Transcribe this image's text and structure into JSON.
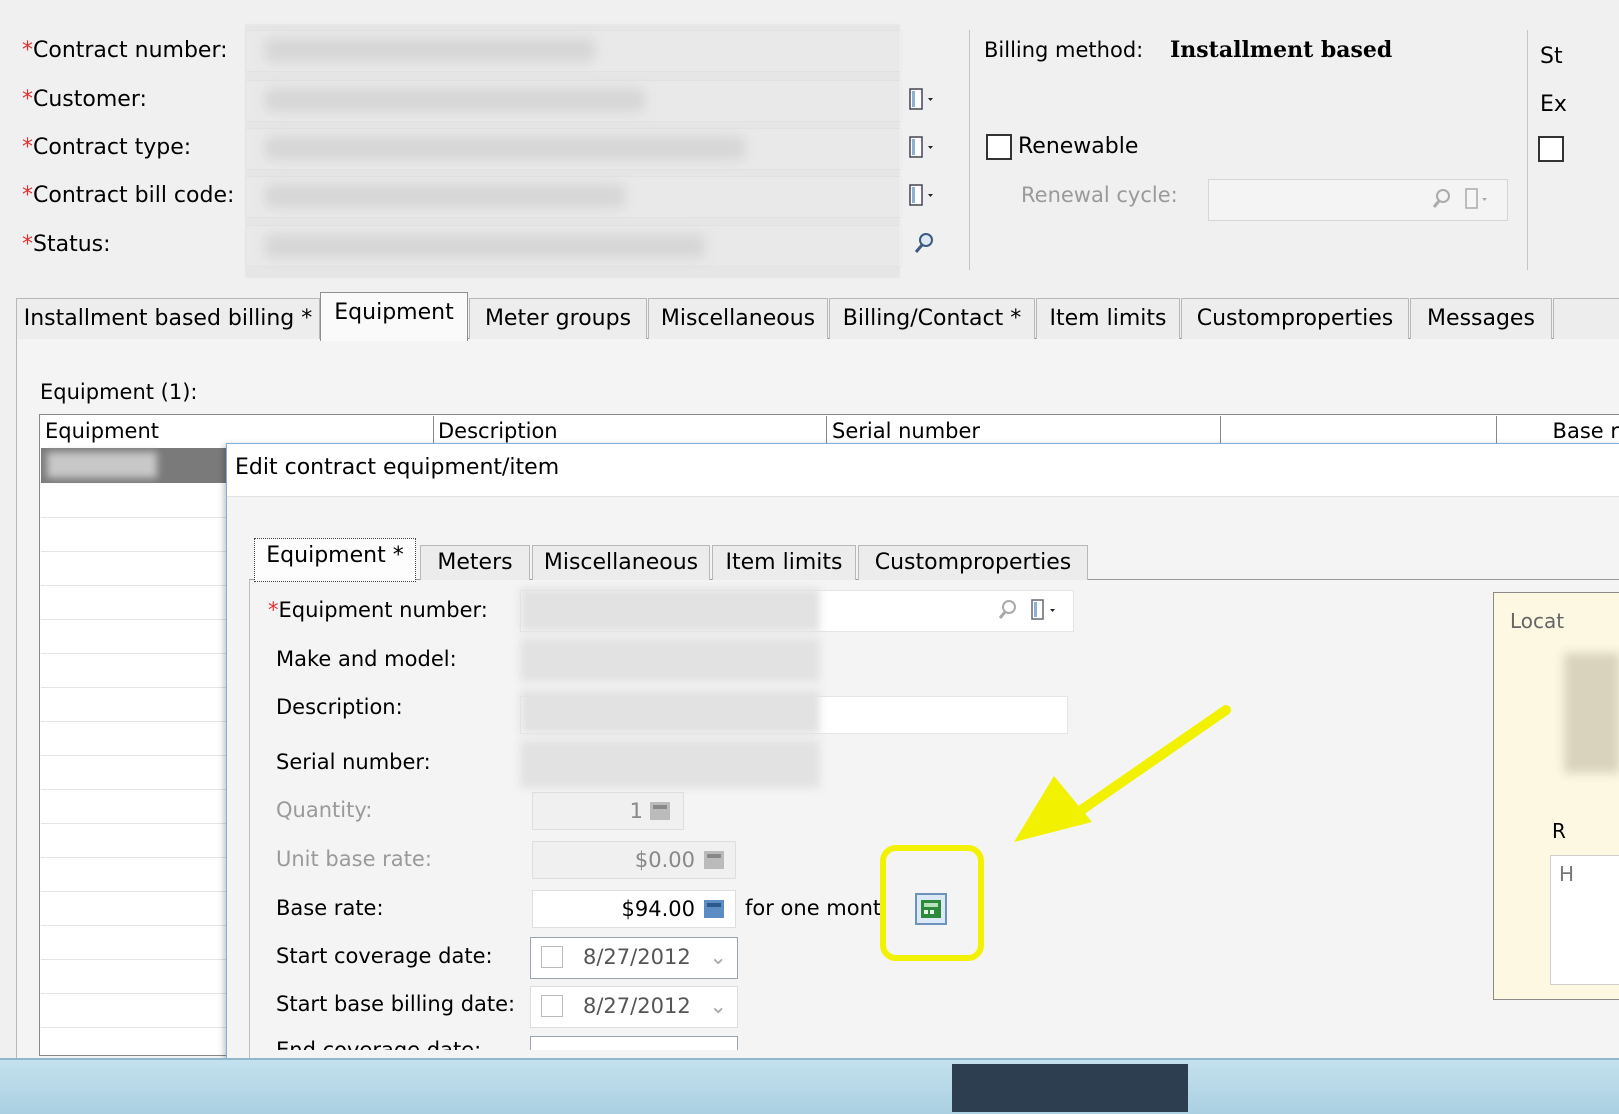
{
  "header": {
    "fields": [
      {
        "label": "Contract number:",
        "required": true
      },
      {
        "label": "Customer:",
        "required": true
      },
      {
        "label": "Contract type:",
        "required": true
      },
      {
        "label": "Contract bill code:",
        "required": true
      },
      {
        "label": "Status:",
        "required": true
      }
    ],
    "billing_method_label": "Billing method:",
    "billing_method_value": "Installment based",
    "renewable_label": "Renewable",
    "renewal_cycle_label": "Renewal cycle:",
    "right_partial_1": "St",
    "right_partial_2": "Ex"
  },
  "tabs": [
    {
      "label": "Installment based billing *",
      "active": false
    },
    {
      "label": "Equipment",
      "active": true
    },
    {
      "label": "Meter groups",
      "active": false
    },
    {
      "label": "Miscellaneous",
      "active": false
    },
    {
      "label": "Billing/Contact *",
      "active": false
    },
    {
      "label": "Item limits",
      "active": false
    },
    {
      "label": "Customproperties",
      "active": false
    },
    {
      "label": "Messages",
      "active": false
    }
  ],
  "equipment_section": {
    "title": "Equipment (1):",
    "columns": [
      "Equipment",
      "Description",
      "Serial number",
      "",
      "Base r"
    ]
  },
  "dialog": {
    "title": "Edit contract equipment/item",
    "tabs": [
      {
        "label": "Equipment *",
        "active": true
      },
      {
        "label": "Meters",
        "active": false
      },
      {
        "label": "Miscellaneous",
        "active": false
      },
      {
        "label": "Item limits",
        "active": false
      },
      {
        "label": "Customproperties",
        "active": false
      }
    ],
    "fields": {
      "equipment_number_label": "Equipment number:",
      "make_model_label": "Make and model:",
      "description_label": "Description:",
      "serial_label": "Serial number:",
      "quantity_label": "Quantity:",
      "quantity_value": "1",
      "unit_base_rate_label": "Unit base rate:",
      "unit_base_rate_value": "$0.00",
      "base_rate_label": "Base rate:",
      "base_rate_value": "$94.00",
      "base_rate_suffix": "for one mont",
      "start_coverage_label": "Start coverage date:",
      "start_coverage_value": "8/27/2012",
      "start_billing_label": "Start base billing date:",
      "start_billing_value": "8/27/2012",
      "end_coverage_label": "End coverage date:"
    },
    "location_panel_label": "Locat",
    "location_r_label": "R",
    "location_h_label": "H"
  },
  "annotation": {
    "highlight_color": "#f2f200",
    "arrow_color": "#f2f200"
  }
}
